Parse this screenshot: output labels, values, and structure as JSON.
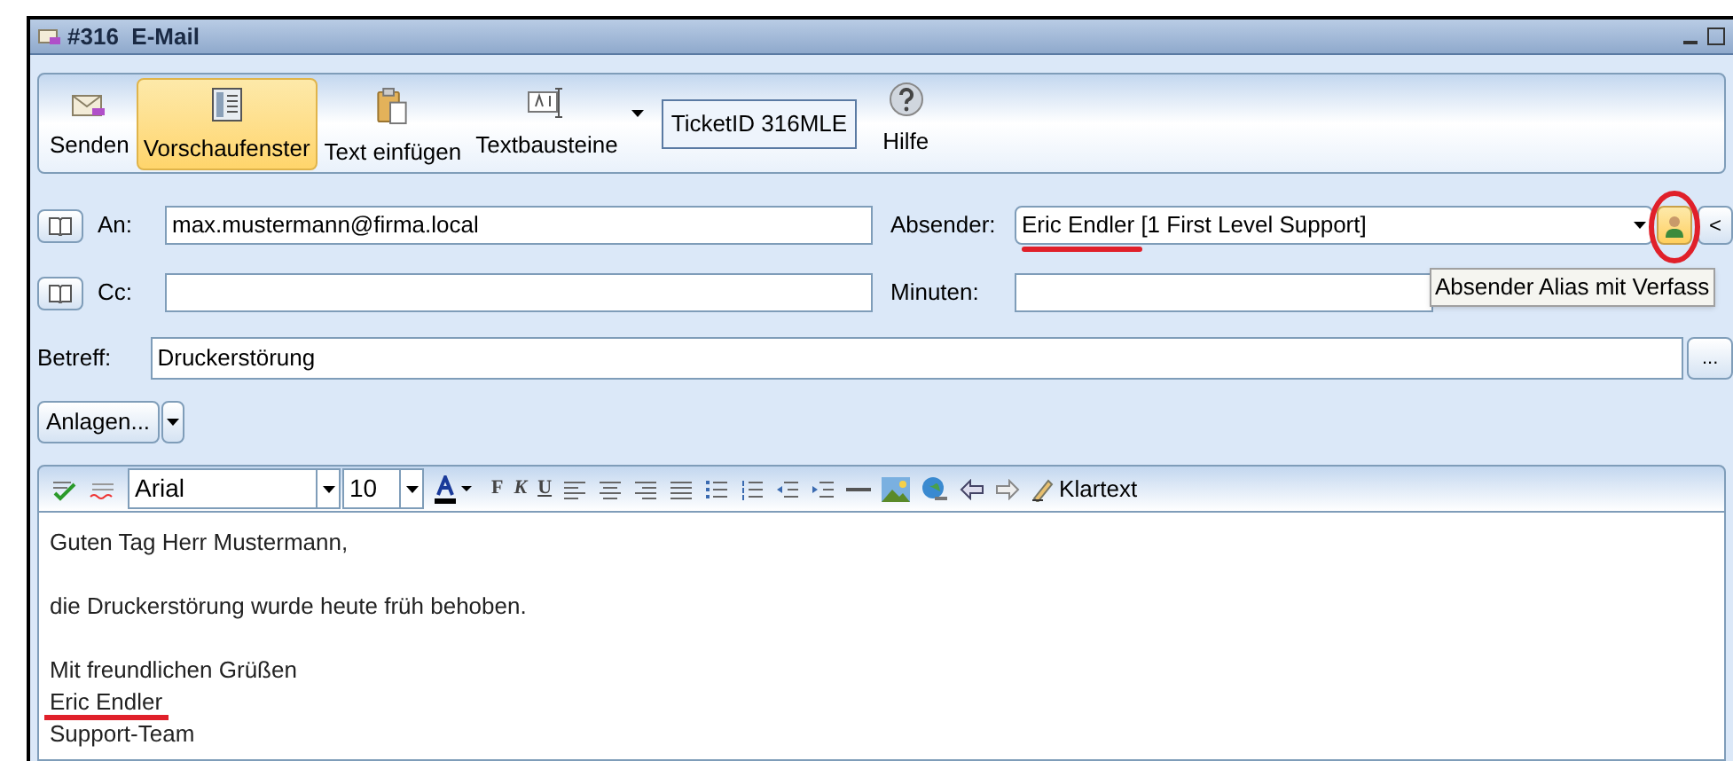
{
  "window": {
    "title": "#316  E-Mail"
  },
  "toolbar": {
    "buttons": [
      {
        "kind": "send",
        "label": "Senden",
        "selected": false
      },
      {
        "kind": "preview",
        "label": "Vorschaufenster",
        "selected": true
      },
      {
        "kind": "paste",
        "label": "Text einfügen",
        "selected": false
      },
      {
        "kind": "snippets",
        "label": "Textbausteine",
        "selected": false
      }
    ],
    "ticket_id": "TicketID 316MLE",
    "help": "Hilfe"
  },
  "to": {
    "label": "An:",
    "value": "max.mustermann@firma.local"
  },
  "cc": {
    "label": "Cc:"
  },
  "sender": {
    "label": "Absender:",
    "value_highlighted": "Eric Endler",
    "value_rest": " [1 First Level Support]",
    "alias_button_circled": true,
    "more_button": "<"
  },
  "minutes": {
    "label": "Minuten:"
  },
  "tooltip": "Absender Alias mit Verfass",
  "subject": {
    "label": "Betreff:",
    "value": "Druckerstörung",
    "more_button": "..."
  },
  "attachments_button": "Anlagen...",
  "format": {
    "font": "Arial",
    "size": "10",
    "bold": "F",
    "italic": "K",
    "underline": "U",
    "plain_text": "Klartext"
  },
  "body": [
    {
      "lines": [
        {
          "text": "Guten Tag Herr Mustermann,",
          "highlighted": false
        }
      ]
    },
    {
      "lines": [
        {
          "text": "die Druckerstörung wurde heute früh behoben.",
          "highlighted": false
        }
      ]
    },
    {
      "lines": [
        {
          "text": "Mit freundlichen Grüßen",
          "highlighted": false
        },
        {
          "text": "Eric Endler",
          "highlighted": true
        },
        {
          "text": "Support-Team",
          "highlighted": false
        }
      ]
    }
  ]
}
